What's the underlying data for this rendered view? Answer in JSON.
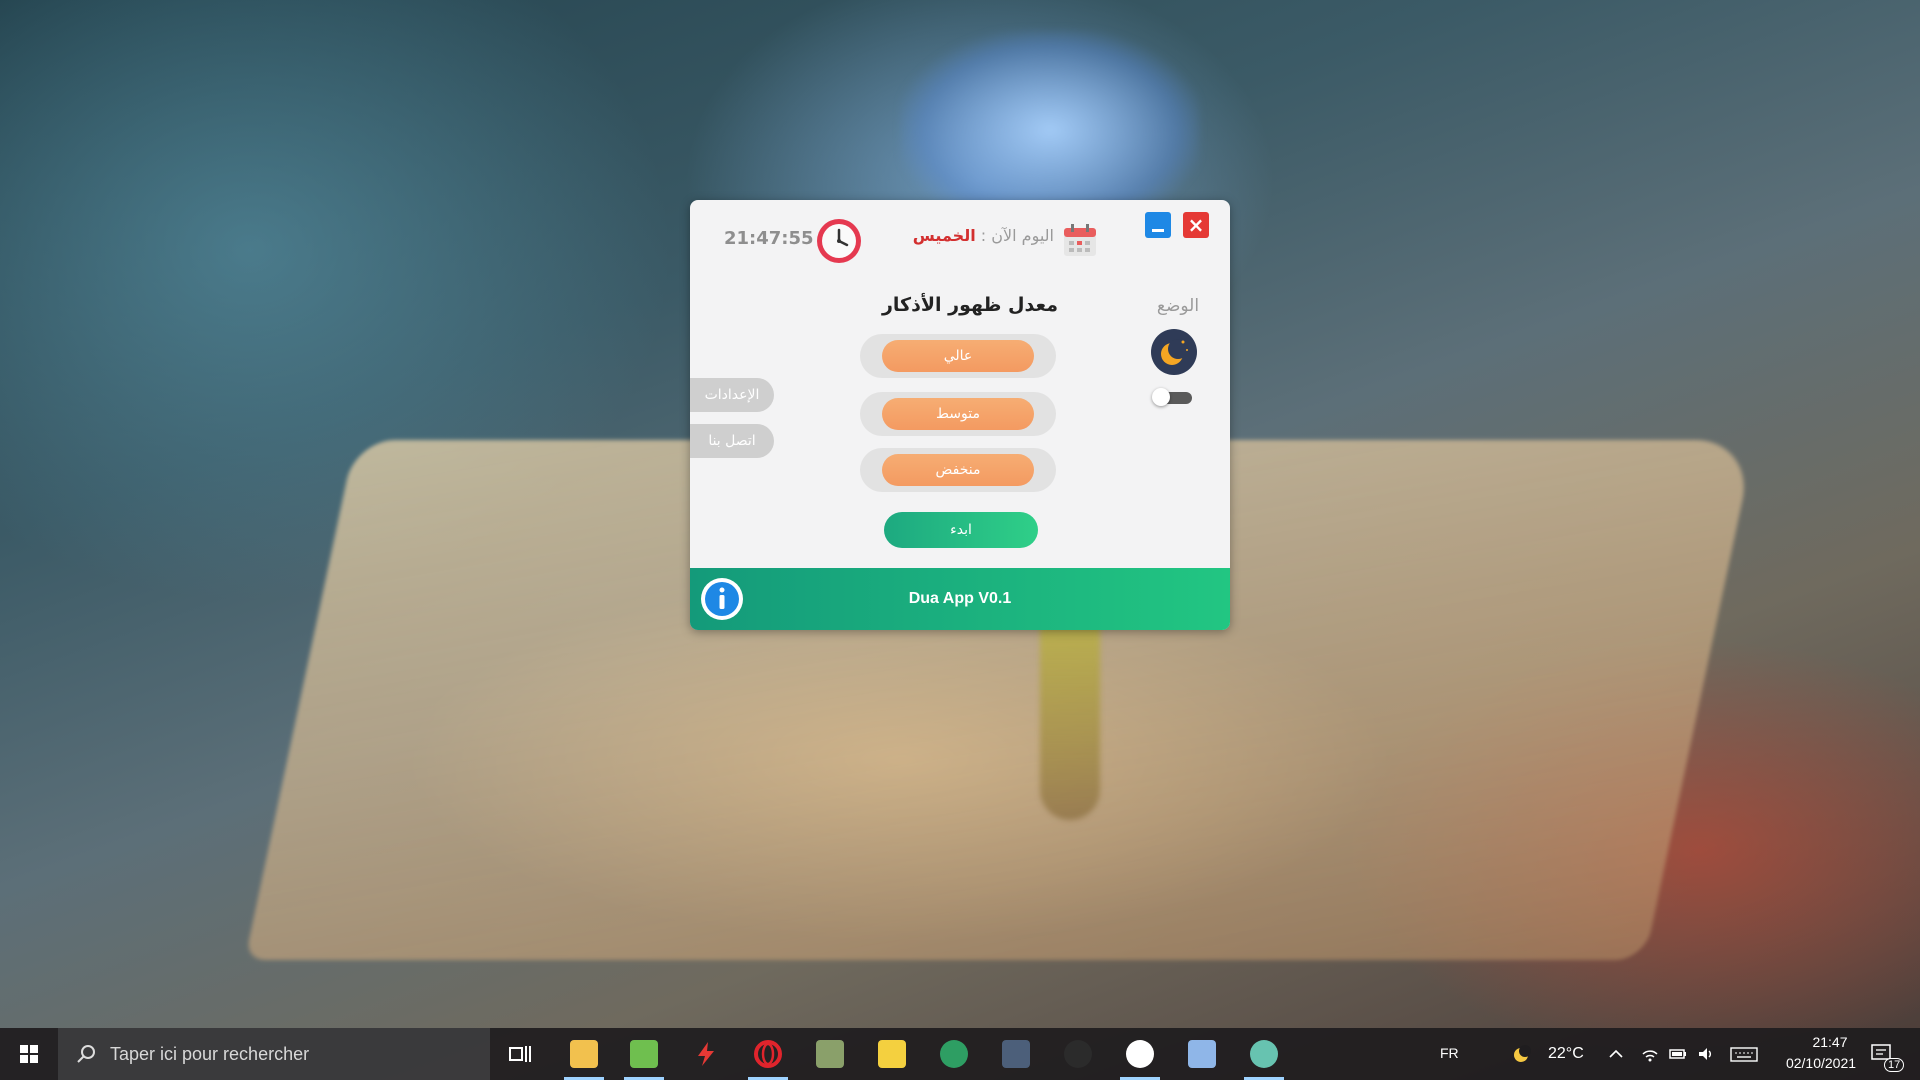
{
  "app": {
    "date_label": "اليوم الآن :",
    "date_value": "الخميس",
    "time": "21:47:55",
    "mode_label": "الوضع",
    "section_title": "معدل ظهور الأذكار",
    "options": [
      "عالي",
      "متوسط",
      "منخفض"
    ],
    "start_label": "ابدء",
    "side_buttons": [
      "الإعدادات",
      "اتصل بنا"
    ],
    "footer_title": "Dua App  V0.1",
    "dark_mode_on": false,
    "colors": {
      "orange": "#f49a61",
      "green": "#1da980",
      "minimize": "#1e88e5",
      "close": "#e53935",
      "date_value": "#d32f2f"
    }
  },
  "taskbar": {
    "search_placeholder": "Taper ici pour rechercher",
    "language": "FR",
    "temperature": "22°C",
    "clock_time": "21:47",
    "clock_date": "02/10/2021",
    "notification_count": "17"
  }
}
